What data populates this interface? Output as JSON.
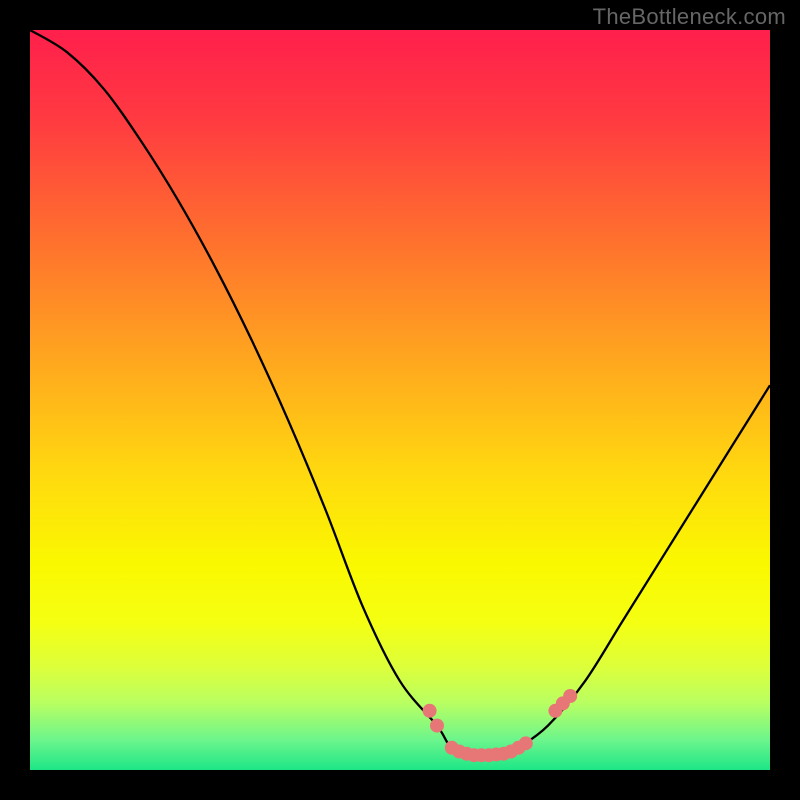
{
  "watermark": "TheBottleneck.com",
  "chart_data": {
    "type": "line",
    "title": "",
    "xlabel": "",
    "ylabel": "",
    "xlim": [
      0,
      100
    ],
    "ylim": [
      0,
      100
    ],
    "grid": false,
    "series": [
      {
        "name": "curve",
        "x": [
          0,
          5,
          10,
          15,
          20,
          25,
          30,
          35,
          40,
          45,
          50,
          55,
          57,
          60,
          62,
          64,
          66,
          70,
          75,
          80,
          85,
          90,
          95,
          100
        ],
        "y": [
          100,
          97,
          92,
          85,
          77,
          68,
          58,
          47,
          35,
          22,
          12,
          6,
          3,
          2,
          2,
          2,
          3,
          6,
          12,
          20,
          28,
          36,
          44,
          52
        ],
        "color": "#000000",
        "width": 2.3
      }
    ],
    "markers": {
      "name": "dots",
      "color": "#E77777",
      "radius": 7,
      "points": [
        {
          "x": 54,
          "y": 8.0
        },
        {
          "x": 55,
          "y": 6.0
        },
        {
          "x": 57,
          "y": 3.0
        },
        {
          "x": 58,
          "y": 2.5
        },
        {
          "x": 59,
          "y": 2.2
        },
        {
          "x": 60,
          "y": 2.0
        },
        {
          "x": 61,
          "y": 2.0
        },
        {
          "x": 62,
          "y": 2.0
        },
        {
          "x": 63,
          "y": 2.1
        },
        {
          "x": 64,
          "y": 2.2
        },
        {
          "x": 65,
          "y": 2.5
        },
        {
          "x": 66,
          "y": 3.0
        },
        {
          "x": 67,
          "y": 3.6
        },
        {
          "x": 71,
          "y": 8.0
        },
        {
          "x": 72,
          "y": 9.0
        },
        {
          "x": 73,
          "y": 10.0
        }
      ]
    },
    "background_stops": [
      {
        "offset": 0.0,
        "color": "#FF1F4C"
      },
      {
        "offset": 0.12,
        "color": "#FF3A41"
      },
      {
        "offset": 0.28,
        "color": "#FF6F2E"
      },
      {
        "offset": 0.45,
        "color": "#FFA81E"
      },
      {
        "offset": 0.6,
        "color": "#FFD90F"
      },
      {
        "offset": 0.72,
        "color": "#FAF800"
      },
      {
        "offset": 0.8,
        "color": "#F5FF12"
      },
      {
        "offset": 0.86,
        "color": "#DDFF3A"
      },
      {
        "offset": 0.91,
        "color": "#B8FF62"
      },
      {
        "offset": 0.96,
        "color": "#6BF58C"
      },
      {
        "offset": 1.0,
        "color": "#1DE687"
      }
    ]
  }
}
